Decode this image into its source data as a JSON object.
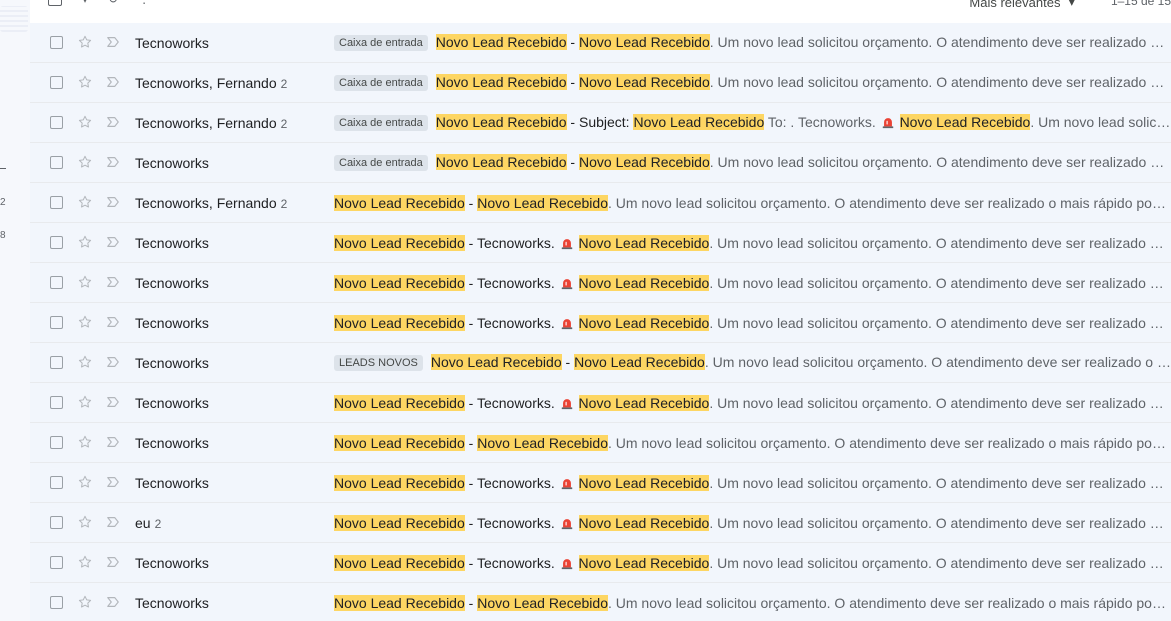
{
  "toolbar": {
    "sort_label": "Mais relevantes",
    "range_text": "1–15 de 15"
  },
  "sidebar": {
    "count_a": "2",
    "count_b": "8"
  },
  "rows": [
    {
      "sender": "Tecnoworks",
      "count": "",
      "label": "Caixa de entrada",
      "parts": [
        {
          "t": "Novo Lead Recebido",
          "k": "hl"
        },
        {
          "t": " - ",
          "k": "subj"
        },
        {
          "t": "Novo Lead Recebido",
          "k": "hl"
        },
        {
          "t": ". Um novo lead solicitou orçamento. O atendimento deve ser realizado o mais rápido possível.",
          "k": "snip"
        }
      ]
    },
    {
      "sender": "Tecnoworks, Fernando",
      "count": "2",
      "label": "Caixa de entrada",
      "parts": [
        {
          "t": "Novo Lead Recebido",
          "k": "hl"
        },
        {
          "t": " - ",
          "k": "subj"
        },
        {
          "t": "Novo Lead Recebido",
          "k": "hl"
        },
        {
          "t": ". Um novo lead solicitou orçamento. O atendimento deve ser realizado o mais rápido possível.",
          "k": "snip"
        }
      ]
    },
    {
      "sender": "Tecnoworks, Fernando",
      "count": "2",
      "label": "Caixa de entrada",
      "parts": [
        {
          "t": "Novo Lead Recebido",
          "k": "hl"
        },
        {
          "t": " - Subject: ",
          "k": "subj"
        },
        {
          "t": "Novo Lead Recebido",
          "k": "hl"
        },
        {
          "t": " To: . Tecnoworks. ",
          "k": "snip"
        },
        {
          "t": "siren",
          "k": "icon"
        },
        {
          "t": " ",
          "k": "snip"
        },
        {
          "t": "Novo Lead Recebido",
          "k": "hl"
        },
        {
          "t": ". Um novo lead solicitou orçamento.",
          "k": "snip"
        }
      ]
    },
    {
      "sender": "Tecnoworks",
      "count": "",
      "label": "Caixa de entrada",
      "parts": [
        {
          "t": "Novo Lead Recebido",
          "k": "hl"
        },
        {
          "t": " - ",
          "k": "subj"
        },
        {
          "t": "Novo Lead Recebido",
          "k": "hl"
        },
        {
          "t": ". Um novo lead solicitou orçamento. O atendimento deve ser realizado o mais rápido possível.",
          "k": "snip"
        }
      ]
    },
    {
      "sender": "Tecnoworks, Fernando",
      "count": "2",
      "label": "",
      "parts": [
        {
          "t": "Novo Lead Recebido",
          "k": "hl"
        },
        {
          "t": " - ",
          "k": "subj"
        },
        {
          "t": "Novo Lead Recebido",
          "k": "hl"
        },
        {
          "t": ". Um novo lead solicitou orçamento. O atendimento deve ser realizado o mais rápido possível.",
          "k": "snip"
        }
      ]
    },
    {
      "sender": "Tecnoworks",
      "count": "",
      "label": "",
      "parts": [
        {
          "t": "Novo Lead Recebido",
          "k": "hl"
        },
        {
          "t": " - Tecnoworks. ",
          "k": "subj"
        },
        {
          "t": "siren",
          "k": "icon"
        },
        {
          "t": " ",
          "k": "snip"
        },
        {
          "t": "Novo Lead Recebido",
          "k": "hl"
        },
        {
          "t": ". Um novo lead solicitou orçamento. O atendimento deve ser realizado o mais rápido possível.",
          "k": "snip"
        }
      ]
    },
    {
      "sender": "Tecnoworks",
      "count": "",
      "label": "",
      "parts": [
        {
          "t": "Novo Lead Recebido",
          "k": "hl"
        },
        {
          "t": " - Tecnoworks. ",
          "k": "subj"
        },
        {
          "t": "siren",
          "k": "icon"
        },
        {
          "t": " ",
          "k": "snip"
        },
        {
          "t": "Novo Lead Recebido",
          "k": "hl"
        },
        {
          "t": ". Um novo lead solicitou orçamento. O atendimento deve ser realizado o mais rápido possível.",
          "k": "snip"
        }
      ]
    },
    {
      "sender": "Tecnoworks",
      "count": "",
      "label": "",
      "parts": [
        {
          "t": "Novo Lead Recebido",
          "k": "hl"
        },
        {
          "t": " - Tecnoworks. ",
          "k": "subj"
        },
        {
          "t": "siren",
          "k": "icon"
        },
        {
          "t": " ",
          "k": "snip"
        },
        {
          "t": "Novo Lead Recebido",
          "k": "hl"
        },
        {
          "t": ". Um novo lead solicitou orçamento. O atendimento deve ser realizado o mais rápido possível.",
          "k": "snip"
        }
      ]
    },
    {
      "sender": "Tecnoworks",
      "count": "",
      "label": "LEADS NOVOS",
      "parts": [
        {
          "t": "Novo Lead Recebido",
          "k": "hl"
        },
        {
          "t": " - ",
          "k": "subj"
        },
        {
          "t": "Novo Lead Recebido",
          "k": "hl"
        },
        {
          "t": ". Um novo lead solicitou orçamento. O atendimento deve ser realizado o mais rápido possível.",
          "k": "snip"
        }
      ]
    },
    {
      "sender": "Tecnoworks",
      "count": "",
      "label": "",
      "parts": [
        {
          "t": "Novo Lead Recebido",
          "k": "hl"
        },
        {
          "t": " - Tecnoworks. ",
          "k": "subj"
        },
        {
          "t": "siren",
          "k": "icon"
        },
        {
          "t": " ",
          "k": "snip"
        },
        {
          "t": "Novo Lead Recebido",
          "k": "hl"
        },
        {
          "t": ". Um novo lead solicitou orçamento. O atendimento deve ser realizado o mais rápido possível.",
          "k": "snip"
        }
      ]
    },
    {
      "sender": "Tecnoworks",
      "count": "",
      "label": "",
      "parts": [
        {
          "t": "Novo Lead Recebido",
          "k": "hl"
        },
        {
          "t": " - ",
          "k": "subj"
        },
        {
          "t": "Novo Lead Recebido",
          "k": "hl"
        },
        {
          "t": ". Um novo lead solicitou orçamento. O atendimento deve ser realizado o mais rápido possível.",
          "k": "snip"
        }
      ]
    },
    {
      "sender": "Tecnoworks",
      "count": "",
      "label": "",
      "parts": [
        {
          "t": "Novo Lead Recebido",
          "k": "hl"
        },
        {
          "t": " - Tecnoworks. ",
          "k": "subj"
        },
        {
          "t": "siren",
          "k": "icon"
        },
        {
          "t": " ",
          "k": "snip"
        },
        {
          "t": "Novo Lead Recebido",
          "k": "hl"
        },
        {
          "t": ". Um novo lead solicitou orçamento. O atendimento deve ser realizado o mais rápido possível.",
          "k": "snip"
        }
      ]
    },
    {
      "sender": "eu",
      "count": "2",
      "label": "",
      "parts": [
        {
          "t": "Novo Lead Recebido",
          "k": "hl"
        },
        {
          "t": " - Tecnoworks. ",
          "k": "subj"
        },
        {
          "t": "siren",
          "k": "icon"
        },
        {
          "t": " ",
          "k": "snip"
        },
        {
          "t": "Novo Lead Recebido",
          "k": "hl"
        },
        {
          "t": ". Um novo lead solicitou orçamento. O atendimento deve ser realizado o mais rápido possível.",
          "k": "snip"
        }
      ]
    },
    {
      "sender": "Tecnoworks",
      "count": "",
      "label": "",
      "parts": [
        {
          "t": "Novo Lead Recebido",
          "k": "hl"
        },
        {
          "t": " - Tecnoworks. ",
          "k": "subj"
        },
        {
          "t": "siren",
          "k": "icon"
        },
        {
          "t": " ",
          "k": "snip"
        },
        {
          "t": "Novo Lead Recebido",
          "k": "hl"
        },
        {
          "t": ". Um novo lead solicitou orçamento. O atendimento deve ser realizado o mais rápido possível.",
          "k": "snip"
        }
      ]
    },
    {
      "sender": "Tecnoworks",
      "count": "",
      "label": "",
      "parts": [
        {
          "t": "Novo Lead Recebido",
          "k": "hl"
        },
        {
          "t": " - ",
          "k": "subj"
        },
        {
          "t": "Novo Lead Recebido",
          "k": "hl"
        },
        {
          "t": ". Um novo lead solicitou orçamento. O atendimento deve ser realizado o mais rápido possível.",
          "k": "snip"
        }
      ]
    }
  ],
  "colors": {
    "highlight": "#fdd663",
    "row_bg": "#f2f6fc",
    "chip_bg": "#dde3ea"
  }
}
